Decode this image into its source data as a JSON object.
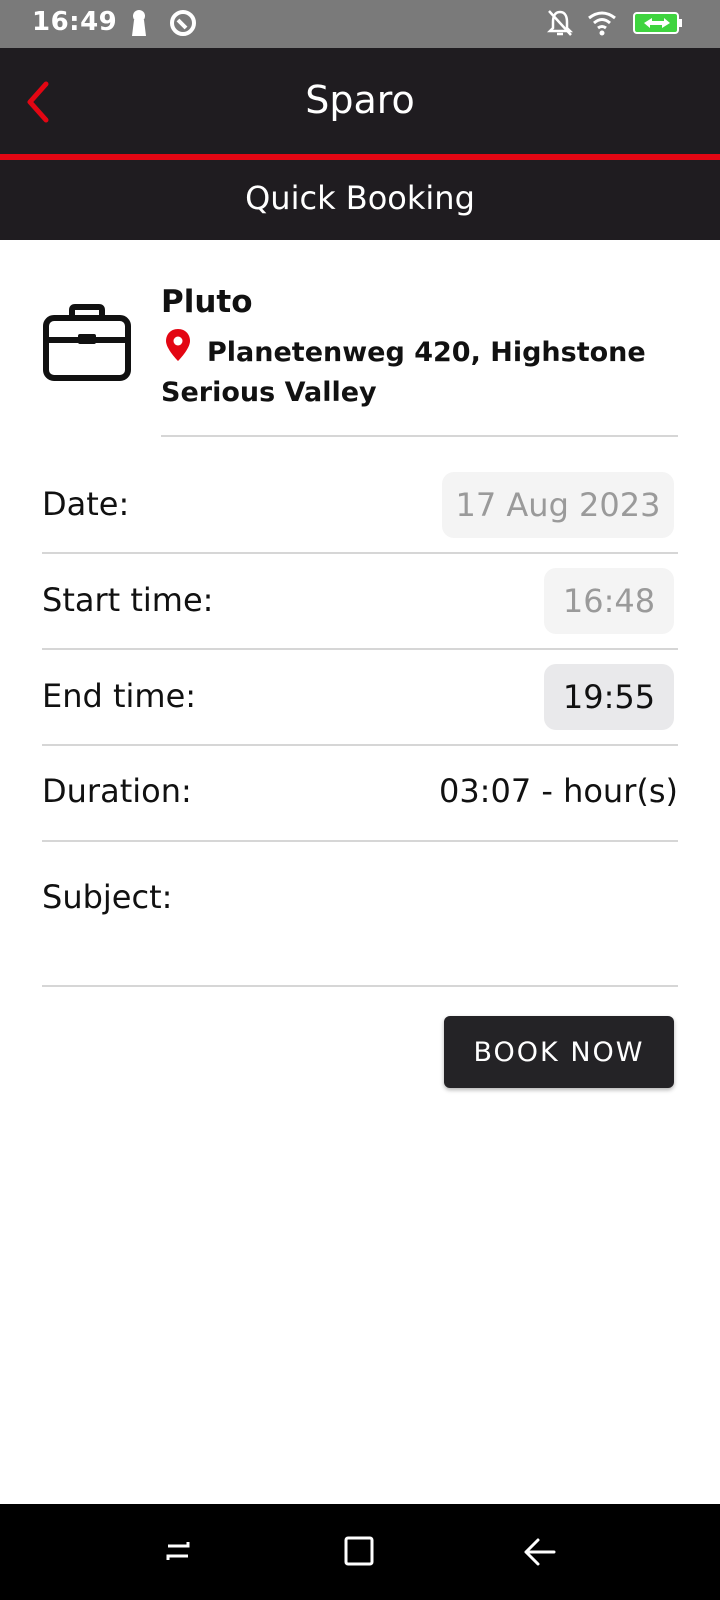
{
  "status_bar": {
    "time": "16:49"
  },
  "app_bar": {
    "title": "Sparo",
    "subtitle": "Quick Booking"
  },
  "venue": {
    "name": "Pluto",
    "address": "Planetenweg 420, Highstone Serious Valley"
  },
  "form": {
    "date": {
      "label": "Date:",
      "value": "17 Aug 2023"
    },
    "start_time": {
      "label": "Start time:",
      "value": "16:48"
    },
    "end_time": {
      "label": "End time:",
      "value": "19:55"
    },
    "duration": {
      "label": "Duration:",
      "value": "03:07 - hour(s)"
    },
    "subject": {
      "label": "Subject:",
      "value": ""
    }
  },
  "actions": {
    "book_label": "BOOK NOW"
  },
  "colors": {
    "accent": "#e30613",
    "bar": "#1f1c20",
    "button": "#242326"
  }
}
